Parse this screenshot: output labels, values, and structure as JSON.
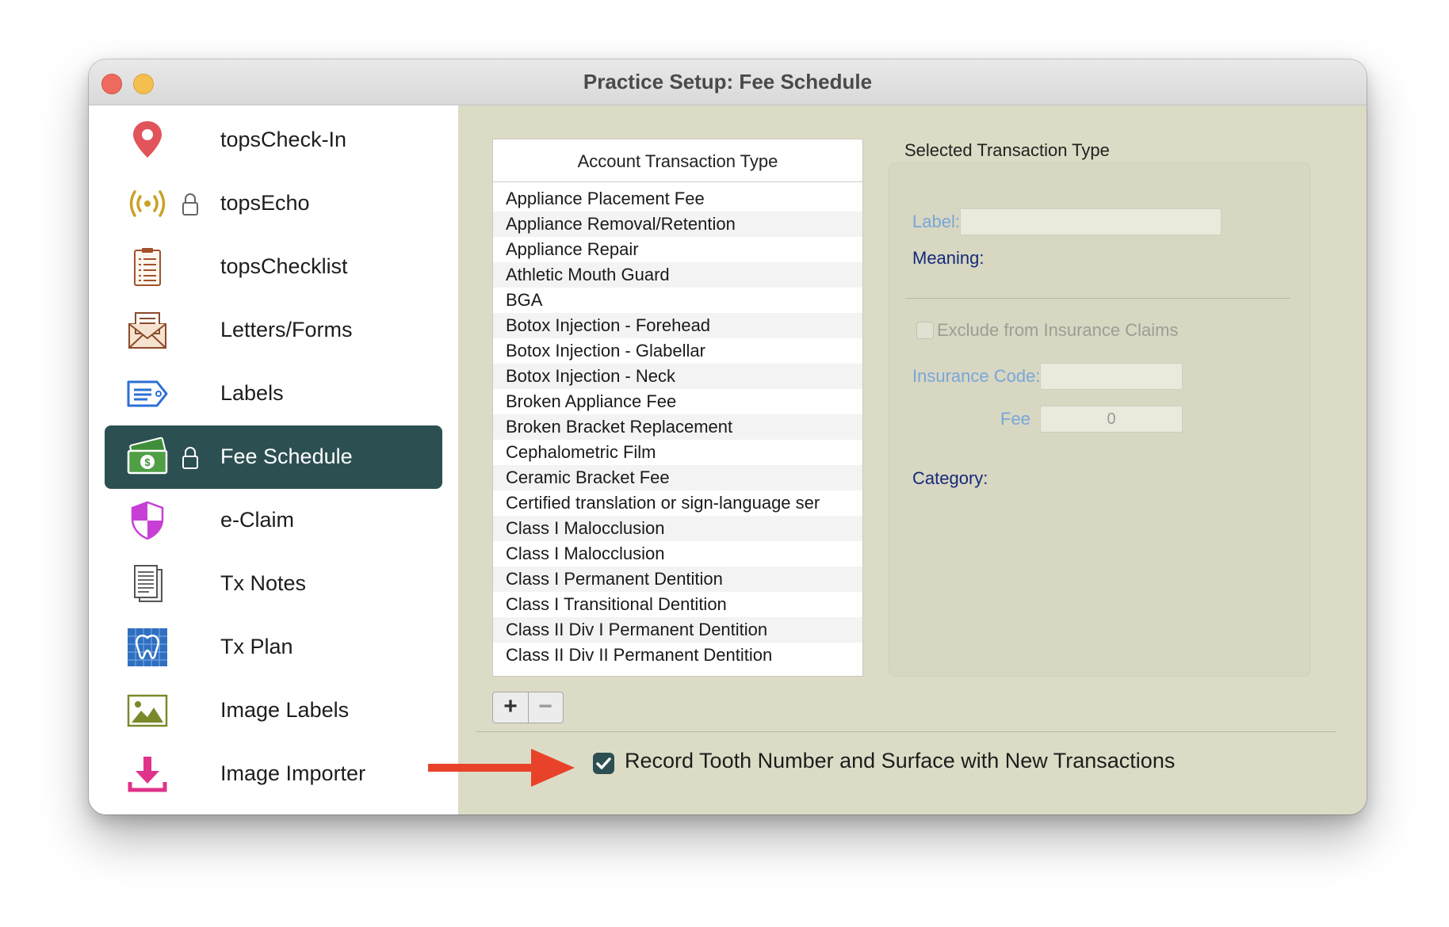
{
  "window": {
    "title": "Practice Setup: Fee Schedule"
  },
  "sidebar": {
    "items": [
      {
        "label": "topsCheck-In",
        "icon": "location-pin-icon",
        "locked": false
      },
      {
        "label": "topsEcho",
        "icon": "broadcast-icon",
        "locked": true
      },
      {
        "label": "topsChecklist",
        "icon": "clipboard-icon",
        "locked": false
      },
      {
        "label": "Letters/Forms",
        "icon": "envelope-icon",
        "locked": false
      },
      {
        "label": "Labels",
        "icon": "tag-icon",
        "locked": false
      },
      {
        "label": "Fee Schedule",
        "icon": "money-icon",
        "locked": true,
        "selected": true
      },
      {
        "label": "e-Claim",
        "icon": "shield-icon",
        "locked": false
      },
      {
        "label": "Tx Notes",
        "icon": "notes-icon",
        "locked": false
      },
      {
        "label": "Tx Plan",
        "icon": "tooth-plan-icon",
        "locked": false
      },
      {
        "label": "Image Labels",
        "icon": "image-icon",
        "locked": false
      },
      {
        "label": "Image Importer",
        "icon": "download-icon",
        "locked": false
      }
    ]
  },
  "table": {
    "header": "Account Transaction Type",
    "rows": [
      "Appliance Placement Fee",
      "Appliance Removal/Retention",
      "Appliance Repair",
      "Athletic Mouth Guard",
      "BGA",
      "Botox Injection - Forehead",
      "Botox Injection - Glabellar",
      "Botox Injection - Neck",
      "Broken Appliance Fee",
      "Broken Bracket Replacement",
      "Cephalometric Film",
      "Ceramic Bracket Fee",
      "Certified translation or sign-language ser",
      "Class I Malocclusion",
      "Class I Malocclusion",
      "Class I Permanent Dentition",
      "Class I Transitional Dentition",
      "Class II Div I Permanent Dentition",
      "Class II Div II Permanent Dentition"
    ],
    "add_label": "+",
    "remove_label": "−"
  },
  "selected": {
    "title": "Selected Transaction Type",
    "label_label": "Label:",
    "label_value": "",
    "meaning_label": "Meaning:",
    "exclude_label": "Exclude from Insurance Claims",
    "exclude_checked": false,
    "insurance_code_label": "Insurance Code:",
    "insurance_code_value": "",
    "fee_label": "Fee",
    "fee_value": "0",
    "category_label": "Category:"
  },
  "footer": {
    "record_label": "Record Tooth Number and Surface with New Transactions",
    "record_checked": true
  },
  "colors": {
    "accent": "#2c4f52",
    "content_bg": "#dcdcc6",
    "annotation_arrow": "#e8432a",
    "disabled_label": "#7aa6d8",
    "label_navy": "#15297a"
  }
}
